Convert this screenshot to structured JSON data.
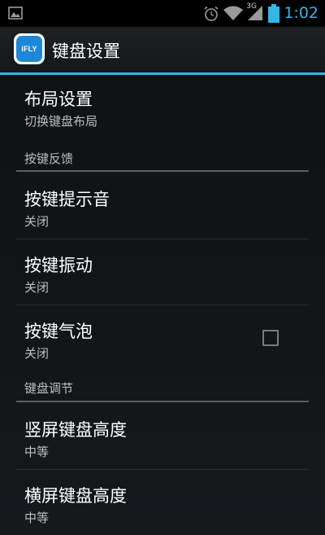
{
  "status_bar": {
    "time": "1:02",
    "network_label": "3G",
    "icons": [
      "image-icon",
      "alarm-icon",
      "wifi-icon",
      "signal-icon",
      "battery-icon"
    ],
    "accent_color": "#33b5e5"
  },
  "action_bar": {
    "app_icon_text": "iFLY",
    "title": "键盘设置",
    "accent_color": "#33b5e5"
  },
  "preferences": [
    {
      "title": "布局设置",
      "summary": "切换键盘布局"
    },
    {
      "category": "按键反馈"
    },
    {
      "title": "按键提示音",
      "summary": "关闭"
    },
    {
      "title": "按键振动",
      "summary": "关闭"
    },
    {
      "title": "按键气泡",
      "summary": "关闭",
      "checkbox_checked": false
    },
    {
      "category": "键盘调节"
    },
    {
      "title": "竖屏键盘高度",
      "summary": "中等"
    },
    {
      "title": "横屏键盘高度",
      "summary": "中等"
    }
  ]
}
